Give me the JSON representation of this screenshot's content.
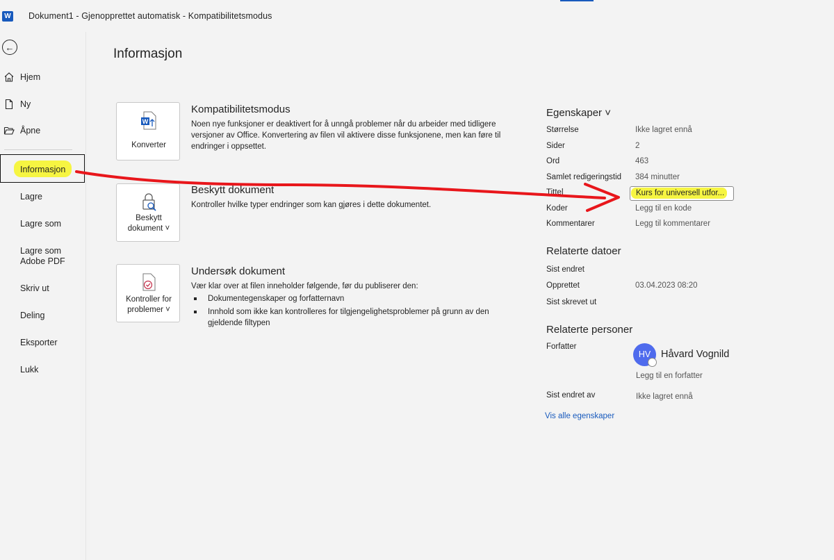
{
  "app": {
    "logo_letter": "W"
  },
  "titlebar": {
    "title": "Dokument1  -  Gjenopprettet automatisk  -  Kompatibilitetsmodus"
  },
  "nav": {
    "back_icon": "back-arrow-icon",
    "items": [
      {
        "label": "Hjem",
        "icon": "home-icon"
      },
      {
        "label": "Ny",
        "icon": "new-document-icon"
      },
      {
        "label": "Åpne",
        "icon": "folder-open-icon"
      },
      {
        "label": "Informasjon"
      },
      {
        "label": "Lagre"
      },
      {
        "label": "Lagre som"
      },
      {
        "label": "Lagre som",
        "label2": "Adobe PDF"
      },
      {
        "label": "Skriv ut"
      },
      {
        "label": "Deling"
      },
      {
        "label": "Eksporter"
      },
      {
        "label": "Lukk"
      }
    ],
    "active": "Informasjon"
  },
  "main": {
    "title": "Informasjon",
    "sections": [
      {
        "button_label": "Konverter",
        "icon": "word-convert-icon",
        "title": "Kompatibilitetsmodus",
        "text": "Noen nye funksjoner er deaktivert for å unngå problemer når du arbeider med tidligere versjoner av Office. Konvertering av filen vil aktivere disse funksjonene, men kan føre til endringer i oppsettet."
      },
      {
        "button_label_1": "Beskytt",
        "button_label_2": "dokument ˅",
        "icon": "lock-search-icon",
        "title": "Beskytt dokument",
        "text": "Kontroller hvilke typer endringer som kan gjøres i dette dokumentet."
      },
      {
        "button_label_1": "Kontroller for",
        "button_label_2": "problemer ˅",
        "icon": "inspect-document-icon",
        "title": "Undersøk dokument",
        "text": "Vær klar over at filen inneholder følgende, før du publiserer den:",
        "bullets": [
          "Dokumentegenskaper og forfatternavn",
          "Innhold som ikke kan kontrolleres for tilgjengelighetsproblemer på grunn av den gjeldende filtypen"
        ]
      }
    ]
  },
  "properties": {
    "heading": "Egenskaper ˅",
    "rows": [
      {
        "label": "Størrelse",
        "value": "Ikke lagret ennå"
      },
      {
        "label": "Sider",
        "value": "2"
      },
      {
        "label": "Ord",
        "value": "463"
      },
      {
        "label": "Samlet redigeringstid",
        "value": "384 minutter"
      },
      {
        "label": "Tittel",
        "value": "Kurs for universell utfor..."
      },
      {
        "label": "Koder",
        "value": "Legg til en kode"
      },
      {
        "label": "Kommentarer",
        "value": "Legg til kommentarer"
      }
    ],
    "dates_heading": "Relaterte datoer",
    "dates": [
      {
        "label": "Sist endret",
        "value": ""
      },
      {
        "label": "Opprettet",
        "value": "03.04.2023 08:20"
      },
      {
        "label": "Sist skrevet ut",
        "value": ""
      }
    ],
    "people_heading": "Relaterte personer",
    "author_label": "Forfatter",
    "author_initials": "HV",
    "author_name": "Håvard Vognild",
    "add_author": "Legg til en forfatter",
    "last_modified_by_label": "Sist endret av",
    "last_modified_by_value": "Ikke lagret ennå",
    "show_all": "Vis alle egenskaper"
  },
  "annotations": {
    "highlight_color": "#f6f542",
    "arrow_color": "#e8161b"
  }
}
